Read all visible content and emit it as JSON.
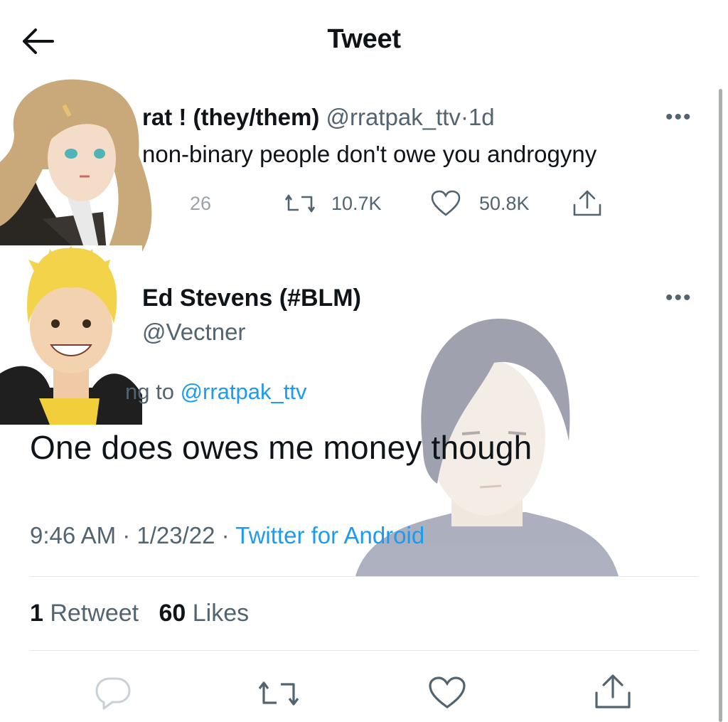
{
  "header": {
    "title": "Tweet"
  },
  "tweet1": {
    "display_name": "rat ! (they/them)",
    "handle": "@rratpak_ttv",
    "separator": "·",
    "age": "1d",
    "more": "•••",
    "text": "non-binary people don't owe you androgyny",
    "replies": "26",
    "retweets": "10.7K",
    "likes": "50.8K"
  },
  "tweet2": {
    "display_name": "Ed Stevens (#BLM)",
    "handle": "@Vectner",
    "more": "•••",
    "replying_partial": "ng to ",
    "replying_handle": "@rratpak_ttv",
    "text": "One does owes me money though",
    "time": "9:46 AM",
    "date": "1/23/22",
    "source": "Twitter for Android",
    "retweet_count": "1",
    "retweet_label": "Retweet",
    "like_count": "60",
    "like_label": "Likes"
  },
  "colors": {
    "accent": "#1d9bf0",
    "secondary_text": "#536471",
    "primary_text": "#0f1419"
  },
  "icons": [
    "back-arrow-icon",
    "reply-icon",
    "retweet-icon",
    "like-icon",
    "share-icon",
    "more-icon"
  ]
}
